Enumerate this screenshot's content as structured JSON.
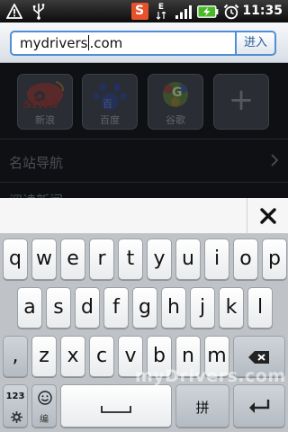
{
  "status_bar": {
    "time": "11:35",
    "icons": [
      "warning-icon",
      "usb-icon",
      "sogou-input-icon",
      "data-e-icon",
      "signal-icon",
      "battery-charging-icon",
      "alarm-icon"
    ],
    "ime_badge": "S",
    "data_badge": "E"
  },
  "browser": {
    "url_value_before_caret": "mydrivers",
    "url_value_after_caret": ".com",
    "go_label": "进入"
  },
  "page": {
    "quick_links": [
      {
        "label": "新浪",
        "logo": "sina"
      },
      {
        "label": "百度",
        "logo": "百"
      },
      {
        "label": "谷歌",
        "logo": "G"
      }
    ],
    "add_symbol": "+",
    "nav_title": "名站导航",
    "nav_second": "阅读新闻"
  },
  "keyboard": {
    "row1": [
      "q",
      "w",
      "e",
      "r",
      "t",
      "y",
      "u",
      "i",
      "o",
      "p"
    ],
    "row2": [
      "a",
      "s",
      "d",
      "f",
      "g",
      "h",
      "j",
      "k",
      "l"
    ],
    "row3_letters": [
      "z",
      "x",
      "c",
      "v",
      "b",
      "n",
      "m"
    ],
    "comma": ",",
    "mode_label": "123",
    "emoji_sub": "编",
    "pinyin_label": "拼",
    "accent_color": "#4e8fd6"
  },
  "watermark": "myDrivers.com"
}
